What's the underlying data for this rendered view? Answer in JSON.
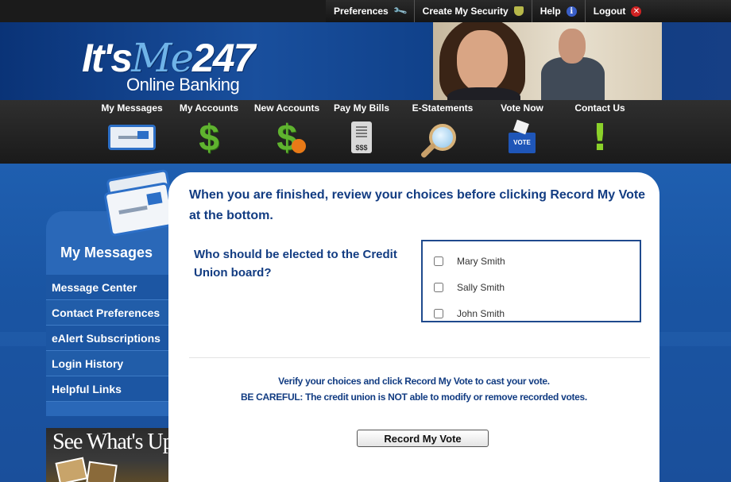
{
  "utility_nav": {
    "preferences": "Preferences",
    "create_security": "Create My Security",
    "help": "Help",
    "logout": "Logout"
  },
  "header": {
    "logo_main_1": "It's",
    "logo_main_2": "Me",
    "logo_main_3": "247",
    "logo_sub": "Online Banking"
  },
  "main_nav": {
    "my_messages": "My Messages",
    "my_accounts": "My Accounts",
    "new_accounts": "New Accounts",
    "pay_my_bills": "Pay My Bills",
    "bill_icon_text": "$$$",
    "e_statements": "E-Statements",
    "vote_now": "Vote Now",
    "vote_icon_text": "VOTE",
    "contact_us": "Contact Us"
  },
  "sidebar": {
    "title": "My Messages",
    "items": [
      {
        "label": "Message Center"
      },
      {
        "label": "Contact Preferences"
      },
      {
        "label": "eAlert Subscriptions"
      },
      {
        "label": "Login History"
      },
      {
        "label": "Helpful Links"
      }
    ],
    "promo_text": "See What's Up"
  },
  "vote": {
    "instructions": "When you are finished, review your choices before clicking Record My Vote at the bottom.",
    "question": "Who should be elected to the Credit Union board?",
    "choices": [
      {
        "label": "Mary Smith",
        "checked": false
      },
      {
        "label": "Sally Smith",
        "checked": false
      },
      {
        "label": "John Smith",
        "checked": false
      }
    ],
    "verify_line1": "Verify your choices and click Record My Vote to cast your vote.",
    "verify_line2": "BE CAREFUL: The credit union is NOT able to modify or remove recorded votes.",
    "record_button": "Record My Vote"
  },
  "colors": {
    "brand_blue": "#123c82",
    "page_blue": "#1f5fb0",
    "nav_dark": "#1a1a1a"
  }
}
